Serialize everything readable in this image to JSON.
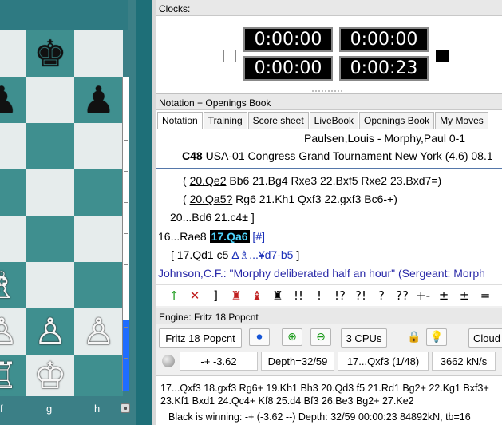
{
  "board": {
    "files": [
      "f",
      "g",
      "h"
    ],
    "squares": [
      [
        "",
        "♚",
        ""
      ],
      [
        "♟",
        "",
        "♟"
      ],
      [
        "",
        "",
        ""
      ],
      [
        "",
        "",
        ""
      ],
      [
        "",
        "",
        ""
      ],
      [
        "♗",
        "",
        ""
      ],
      [
        "♙",
        "♙",
        "♙"
      ],
      [
        "♖",
        "♔",
        ""
      ]
    ],
    "eval_bar_white_fraction": 0.23
  },
  "clocks": {
    "title": "Clocks:",
    "white_top": "0:00:00",
    "black_top": "0:00:00",
    "white_bottom": "0:00:00",
    "black_bottom": "0:00:23"
  },
  "notation": {
    "panel_title": "Notation + Openings Book",
    "tabs": [
      "Notation",
      "Training",
      "Score sheet",
      "LiveBook",
      "Openings Book",
      "My Moves"
    ],
    "active_tab": "Notation",
    "header": {
      "players": "Paulsen,Louis - Morphy,Paul  0-1",
      "eco": "C48",
      "event": "USA-01 Congress Grand Tournament New York (4.6) 08.1"
    },
    "lines": {
      "l1_pre": "( ",
      "l1_u": "20.Qe2",
      "l1_post": " Bb6 21.Bg4 Rxe3 22.Bxf5 Rxe2 23.Bxd7=)",
      "l2_pre": "( ",
      "l2_u": "20.Qa5?",
      "l2_post": " Rg6 21.Kh1 Qxf3 22.gxf3 Bc6-+)",
      "l3": "20...Bd6 21.c4± ]",
      "l4_pre": "16...Rae8 ",
      "l4_hl": "17.Qa6",
      "l4_post": " [#]",
      "l5_pre": "[ ",
      "l5_u": "17.Qd1",
      "l5_post": " c5 ",
      "l5_blue": "Δ♗...¥d7-b5",
      "l5_end": " ]",
      "comment": "Johnson,C.F.: \"Morphy deliberated half an hour\" (Sergeant: Morph"
    },
    "toolbar": [
      "↑",
      "✕",
      "]",
      "♜",
      "♝",
      "♜",
      "!!",
      "!",
      "!?",
      "?!",
      "?",
      "??",
      "+-",
      "±",
      "±",
      "="
    ]
  },
  "engine": {
    "panel_title": "Engine: Fritz 18 Popcnt",
    "name": "Fritz 18 Popcnt",
    "cpus": "3 CPUs",
    "cloud": "Cloud",
    "eval": "-+ -3.62",
    "depth": "Depth=32/59",
    "current_move": "17...Qxf3 (1/48)",
    "speed": "3662 kN/s",
    "pv_line1": "17...Qxf3 18.gxf3 Rg6+ 19.Kh1 Bh3 20.Qd3 f5 21.Rd1 Bg2+ 22.Kg1 Bxf3+",
    "pv_line2": "23.Kf1 Bxd1 24.Qc4+ Kf8 25.d4 Bf3 26.Be3 Bg2+ 27.Ke2",
    "status": "Black is winning: -+ (-3.62 --)  Depth: 32/59   00:00:23  84892kN, tb=16"
  }
}
